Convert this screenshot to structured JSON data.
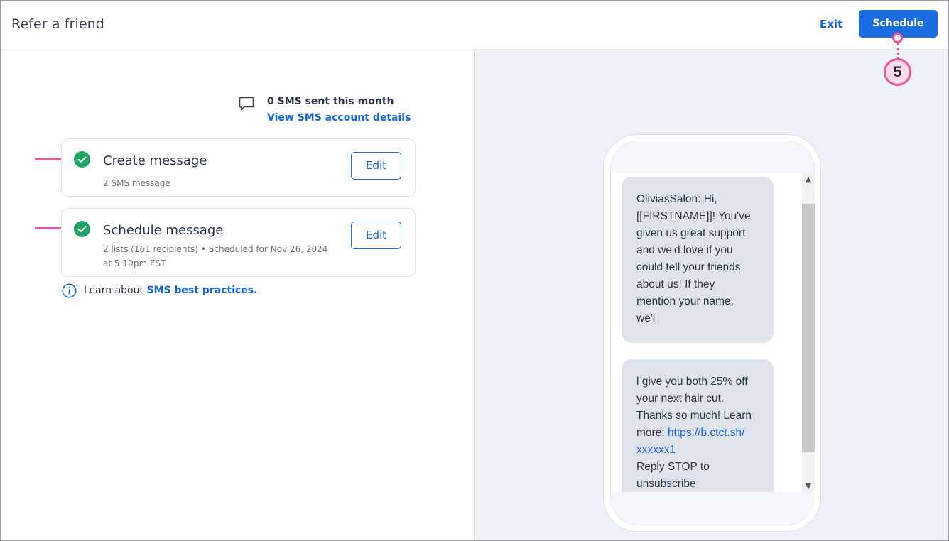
{
  "header": {
    "title": "Refer a friend",
    "exit_label": "Exit",
    "schedule_label": "Schedule"
  },
  "annotation": {
    "step_number": "5",
    "color": "#e8559a"
  },
  "sms_summary": {
    "sent_text": "0 SMS sent this month",
    "account_link": "View SMS account details",
    "icon": "chat-bubble-icon"
  },
  "steps": [
    {
      "title": "Create message",
      "subtitle": "2 SMS message",
      "edit_label": "Edit",
      "status_icon": "check-circle-icon",
      "status_color": "#21a366"
    },
    {
      "title": "Schedule message",
      "subtitle_line1": "2 lists (161 recipients) • Scheduled for Nov 26, 2024",
      "subtitle_line2": "at 5:10pm EST",
      "edit_label": "Edit",
      "status_icon": "check-circle-icon",
      "status_color": "#21a366"
    }
  ],
  "info": {
    "prefix": "Learn about ",
    "link": "SMS best practices.",
    "icon": "info-circle-icon"
  },
  "preview": {
    "bubble1_lines": [
      "OliviasSalon: Hi,",
      "[[FIRSTNAME]]! You've",
      "given us great support",
      "and we'd love if you",
      "could tell your friends",
      "about us! If they",
      "mention your name,",
      "we'l"
    ],
    "bubble2_lines": [
      "l give you both 25% off",
      "your next hair cut.",
      "Thanks so much! Learn",
      "more: "
    ],
    "bubble2_link_part1": "https://b.ctct.sh/",
    "bubble2_link_part2": "xxxxxx1",
    "bubble2_tail": [
      "Reply STOP to",
      "unsubscribe"
    ]
  },
  "colors": {
    "accent": "#1b6ce0",
    "link": "#1866d6",
    "preview_background": "#eef1f8"
  }
}
